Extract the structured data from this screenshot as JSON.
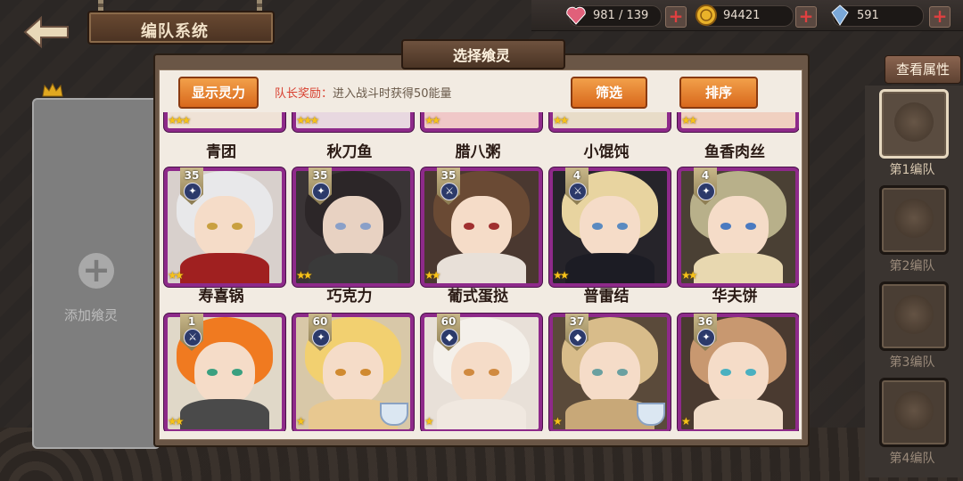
{
  "header": {
    "title": "编队系统"
  },
  "resources": [
    {
      "name": "stamina",
      "icon": "heart-icon",
      "value": "981 / 139",
      "color": "#e0607a"
    },
    {
      "name": "gold",
      "icon": "coin-icon",
      "value": "94421",
      "color": "#e9b22a"
    },
    {
      "name": "crystal",
      "icon": "crystal-icon",
      "value": "591",
      "color": "#7aa8d8"
    }
  ],
  "team_panel": {
    "add_label": "添加飨灵"
  },
  "right_panel": {
    "attr_button": "查看属性",
    "teams": [
      "第1编队",
      "第2编队",
      "第3编队",
      "第4编队"
    ]
  },
  "dialog": {
    "title": "选择飨灵",
    "show_power_button": "显示灵力",
    "captain_label": "队长奖励：",
    "captain_text": "进入战斗时获得50能量",
    "filter_button": "筛选",
    "sort_button": "排序"
  },
  "cards": {
    "row0": [
      {
        "name": "青团",
        "stars": "★★★"
      },
      {
        "name": "秋刀鱼",
        "stars": "★★★"
      },
      {
        "name": "腊八粥",
        "stars": "★★"
      },
      {
        "name": "小馄饨",
        "stars": "★★"
      },
      {
        "name": "鱼香肉丝",
        "stars": "★★"
      }
    ],
    "row1": [
      {
        "name": "寿喜锅",
        "level": "35",
        "stars": "★★",
        "hair": "#e8e8ea",
        "eye": "#c9a040",
        "body": "#a02020"
      },
      {
        "name": "巧克力",
        "level": "35",
        "stars": "★★",
        "hair": "#2c2628",
        "eye": "#8aa0c8",
        "body": "#3a3a3a"
      },
      {
        "name": "葡式蛋挞",
        "level": "35",
        "stars": "★★",
        "hair": "#6a4a34",
        "eye": "#a03030",
        "body": "#e8e0d8"
      },
      {
        "name": "普雷结",
        "level": "4",
        "stars": "★★",
        "hair": "#e8d4a0",
        "eye": "#5a8ac0",
        "body": "#1c1c24"
      },
      {
        "name": "华夫饼",
        "level": "4",
        "stars": "★★",
        "hair": "#b8b08a",
        "eye": "#4a7ac0",
        "body": "#e8d8b0"
      }
    ],
    "row2": [
      {
        "level": "1",
        "stars": "★★",
        "hair": "#f07a20",
        "eye": "#3aa080",
        "body": "#4a4a4a"
      },
      {
        "level": "60",
        "stars": "★",
        "hair": "#f2d070",
        "eye": "#d08a30",
        "body": "#e8c890"
      },
      {
        "level": "60",
        "stars": "★",
        "hair": "#f4f0ea",
        "eye": "#d08a40",
        "body": "#f0e8e0"
      },
      {
        "level": "37",
        "stars": "★",
        "hair": "#d8bc8a",
        "eye": "#6aa0a0",
        "body": "#c8a878"
      },
      {
        "level": "36",
        "stars": "★",
        "hair": "#c89870",
        "eye": "#4ab0c0",
        "body": "#f0dcc8"
      }
    ]
  },
  "colors": {
    "card_border": "#8e2a8a",
    "button_orange": "#e8822c",
    "star": "#f7c21a"
  }
}
